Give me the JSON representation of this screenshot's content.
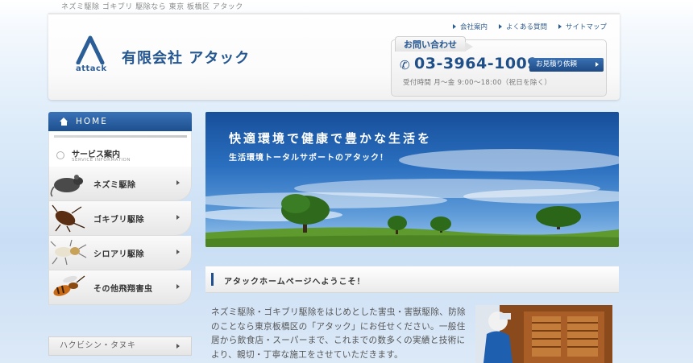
{
  "top_keywords": "ネズミ駆除 ゴキブリ 駆除なら 東京 板橋区 アタック",
  "header": {
    "top_links": [
      "会社案内",
      "よくある質問",
      "サイトマップ"
    ],
    "logo_word": "attack",
    "company_name": "有限会社 アタック",
    "contact": {
      "tab_label": "お問い合わせ",
      "phone": "03-3964-1009",
      "estimate_button": "お見積り依頼",
      "hours": "受付時間 月～金 9:00～18:00（祝日を除く）"
    }
  },
  "sidebar": {
    "home_label": "HOME",
    "service_title": "サービス案内",
    "service_subtitle": "SERVICE INFORMATION",
    "items": [
      {
        "label": "ネズミ駆除",
        "icon": "rat-icon"
      },
      {
        "label": "ゴキブリ駆除",
        "icon": "cockroach-icon"
      },
      {
        "label": "シロアリ駆除",
        "icon": "termite-icon"
      },
      {
        "label": "その他飛翔害虫",
        "icon": "wasp-icon"
      }
    ],
    "other_link": "ハクビシン・タヌキ"
  },
  "banner": {
    "title": "快適環境で健康で豊かな生活を",
    "subtitle": "生活環境トータルサポートのアタック！"
  },
  "main": {
    "welcome_heading": "アタックホームページへようこそ！",
    "intro_text": "ネズミ駆除・ゴキブリ駆除をはじめとした害虫・害獣駆除、防除のことなら東京板橋区の「アタック」にお任せください。一般住居から飲食店・スーパーまで、これまでの数多くの実績と技術により、親切・丁寧な施工をさせていただきます。"
  },
  "colors": {
    "brand_blue": "#1f4f8e",
    "nav_blue": "#2a5c94"
  }
}
